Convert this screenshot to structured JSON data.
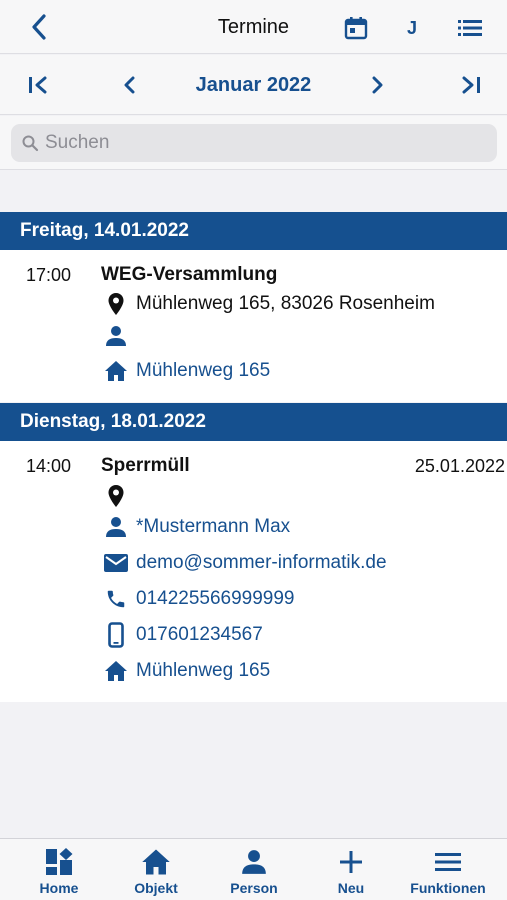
{
  "header": {
    "title": "Termine",
    "j_label": "J"
  },
  "month_nav": {
    "label": "Januar 2022"
  },
  "search": {
    "placeholder": "Suchen"
  },
  "days": [
    {
      "header": "Freitag, 14.01.2022",
      "entry": {
        "time": "17:00",
        "title": "WEG-Versammlung",
        "location": "Mühlenweg 165, 83026 Rosenheim",
        "person": "",
        "object": "Mühlenweg 165"
      }
    },
    {
      "header": "Dienstag, 18.01.2022",
      "entry": {
        "time": "14:00",
        "title": "Sperrmüll",
        "end_date": "25.01.2022",
        "location": "",
        "person": "*Mustermann Max",
        "email": "demo@sommer-informatik.de",
        "phone": "014225566999999",
        "mobile": "017601234567",
        "object": "Mühlenweg 165"
      }
    }
  ],
  "tabs": [
    {
      "label": "Home",
      "icon": "dashboard-icon"
    },
    {
      "label": "Objekt",
      "icon": "home-icon"
    },
    {
      "label": "Person",
      "icon": "person-icon"
    },
    {
      "label": "Neu",
      "icon": "plus-icon"
    },
    {
      "label": "Funktionen",
      "icon": "menu-icon"
    }
  ],
  "colors": {
    "primary": "#15508f",
    "background": "#f2f2f5",
    "card": "#ffffff"
  }
}
